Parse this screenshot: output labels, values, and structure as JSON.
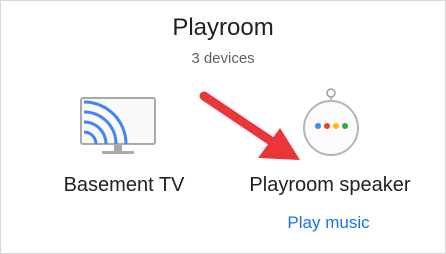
{
  "room": {
    "title": "Playroom",
    "device_count": "3 devices"
  },
  "devices": [
    {
      "label": "Basement TV",
      "icon": "tv-cast-icon"
    },
    {
      "label": "Playroom speaker",
      "icon": "smart-speaker-icon"
    }
  ],
  "action": {
    "label": "Play music"
  },
  "colors": {
    "link": "#1a73e8",
    "icon_blue": "#4285f4",
    "icon_red": "#ea4335",
    "icon_yellow": "#fbbc05",
    "icon_green": "#34a853",
    "annotation_arrow": "#e8363b"
  }
}
